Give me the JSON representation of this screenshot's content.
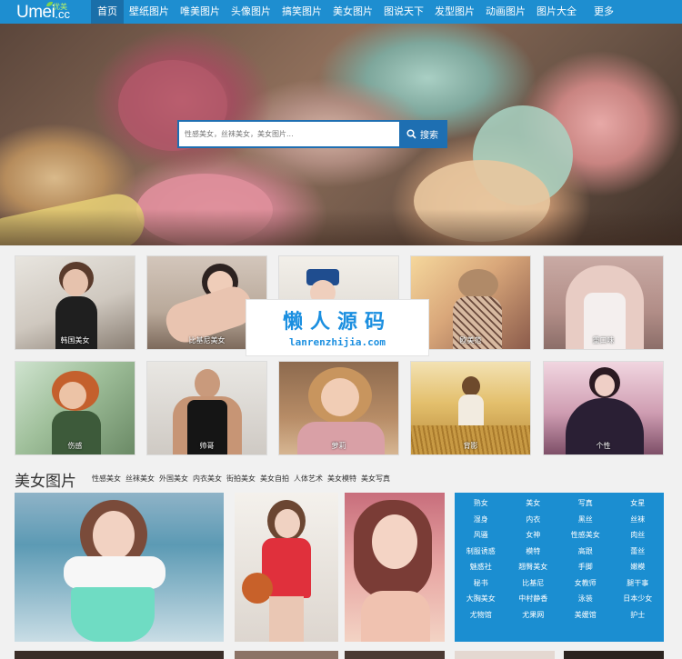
{
  "logo": {
    "text": "Umei",
    "suffix": ".cc",
    "cn": "优美"
  },
  "nav": [
    {
      "label": "首页",
      "active": true,
      "w": 36
    },
    {
      "label": "壁纸图片",
      "w": 56
    },
    {
      "label": "唯美图片",
      "w": 56
    },
    {
      "label": "头像图片",
      "w": 56
    },
    {
      "label": "搞笑图片",
      "w": 56
    },
    {
      "label": "美女图片",
      "w": 56
    },
    {
      "label": "图说天下",
      "w": 56
    },
    {
      "label": "发型图片",
      "w": 56
    },
    {
      "label": "动画图片",
      "w": 56
    },
    {
      "label": "图片大全",
      "w": 56
    },
    {
      "label": "更多",
      "w": 48
    }
  ],
  "search": {
    "placeholder": "性感美女，丝袜美女，美女图片...",
    "button": "搜索"
  },
  "thumbs_row1": [
    "韩国美女",
    "比基尼美女",
    "",
    "欧美范",
    "重口味"
  ],
  "thumbs_row2": [
    "伤感",
    "帅哥",
    "萝莉",
    "背影",
    "个性"
  ],
  "watermark": {
    "cn": "懒人源码",
    "en": "lanrenzhijia.com"
  },
  "section": {
    "title": "美女图片",
    "tags": [
      "性感美女",
      "丝袜美女",
      "外国美女",
      "内衣美女",
      "街拍美女",
      "美女自拍",
      "人体艺术",
      "美女模特",
      "美女写真"
    ]
  },
  "tag_grid": [
    "熟女",
    "美女",
    "写真",
    "女星",
    "湿身",
    "内衣",
    "黑丝",
    "丝袜",
    "风骚",
    "女神",
    "性感美女",
    "肉丝",
    "制服诱惑",
    "模特",
    "高跟",
    "蕾丝",
    "魅惑社",
    "翘臀美女",
    "手脚",
    "嫩模",
    "秘书",
    "比基尼",
    "女教师",
    "腿干事",
    "大胸美女",
    "中村静香",
    "泳装",
    "日本少女",
    "尤物馆",
    "尤果网",
    "美媛馆",
    "护士"
  ]
}
